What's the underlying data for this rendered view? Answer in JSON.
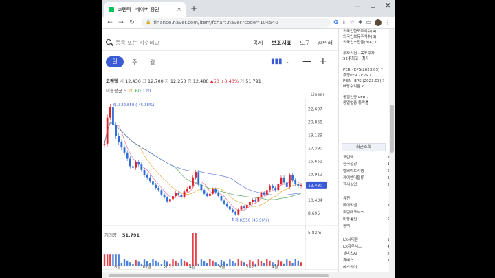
{
  "browser": {
    "tab_title": "코렌텍 : 네이버 증권",
    "tab_close": "×",
    "new_tab": "+",
    "url": "finance.naver.com/item/fchart.naver?code=104540",
    "back": "←",
    "forward": "→",
    "reload": "↻",
    "google": "G",
    "share": "⇪",
    "star": "☆",
    "extensions": "✱",
    "sidepanel": "▭",
    "menu": "⋮",
    "minimize": "—",
    "maximize": "☐",
    "close": "✕"
  },
  "search": {
    "placeholder": "종목 또는 지수비교"
  },
  "top_menu": {
    "notice": "공시",
    "indicator": "보조지표",
    "tool": "도구",
    "print": "인쇄"
  },
  "period": {
    "day": "일",
    "week": "주",
    "month": "월"
  },
  "controls": {
    "chart_type": "▮▮▮",
    "dropdown": "⌄",
    "zoom_out": "—",
    "zoom_in": "+"
  },
  "quote": {
    "name": "코렌텍",
    "open_label": "시",
    "open": "12,430",
    "high_label": "고",
    "high": "12,700",
    "low_label": "저",
    "low": "12,250",
    "close_label": "종",
    "close": "12,480",
    "change": "▲50",
    "change_pct": "+0.40%",
    "volume_label": "거",
    "volume": "51,791"
  },
  "ma": {
    "label": "이동평균",
    "ma5": "5",
    "ma20": "20",
    "ma60": "60",
    "ma120": "120"
  },
  "scale_mode": "Linear",
  "chart_data": {
    "type": "line",
    "x": [
      "6월",
      "10월",
      "2022",
      "4월",
      "8월",
      "2023",
      "4월"
    ],
    "y_ticks": [
      "22,607",
      "20,868",
      "19,129",
      "17,390",
      "15,651",
      "13,912",
      "12,480",
      "10,434",
      "8,695"
    ],
    "last_price_label": "12,480",
    "max_annotation": "최고 22,850 (-45.38%)",
    "min_annotation": "최저 8,550 (45.96%)",
    "volume_label": "거래량",
    "volume_value": "51,791",
    "volume_max_tick": "5.82m",
    "series": [
      {
        "values": [
          18000,
          21500,
          22850,
          20500,
          19000,
          18200,
          17500,
          16800,
          16000,
          15000,
          14800,
          15500,
          15200,
          14500,
          13800,
          13500,
          13000,
          12500,
          12100,
          11800,
          11200,
          10800,
          10300,
          10600,
          11000,
          11400,
          11200,
          10900,
          11600,
          12000,
          12400,
          13500,
          14200,
          12500,
          11800,
          11300,
          11000,
          11300,
          11900,
          11500,
          11000,
          10400,
          10000,
          9600,
          9200,
          8900,
          8550,
          9200,
          9600,
          9400,
          9800,
          10200,
          10500,
          10300,
          10900,
          11500,
          11200,
          11800,
          12400,
          12100,
          11800,
          12600,
          13500,
          12800,
          12200,
          13800,
          13200,
          12600,
          12300,
          12480
        ]
      }
    ],
    "colors": {
      "up": "#e0212a",
      "down": "#2d6fd6",
      "ma5": "#e46c94",
      "ma20": "#e2a325",
      "ma60": "#43a150",
      "ma120": "#5a6fd8",
      "price_badge": "#3b5bd6"
    }
  },
  "sidebar": {
    "info_lines": [
      "외국인한도주식수(A)",
      "외국인보유주식수(B)",
      "외국인소진율(B/A) ?",
      "",
      "투자의견 · 목표주가",
      "52주최고 · 최저",
      "",
      "PER · EPS(2023.03) ?",
      "추정PER · EPS ?",
      "PBR · BPS (2023.03) ?",
      "배당수익률 ?",
      "",
      "동일업종 PER ·",
      "동일업종 등락률 ·"
    ],
    "recent_title": "최근조회",
    "recent_items": [
      {
        "name": "코렌텍",
        "num": "1"
      },
      {
        "name": "한국철강",
        "num": "1"
      },
      {
        "name": "엘의아트라켐",
        "num": "2"
      },
      {
        "name": "케이엔더블류",
        "num": "3"
      },
      {
        "name": "한세실업",
        "num": "2"
      },
      {
        "name": "",
        "num": ""
      },
      {
        "name": "유진",
        "num": ""
      },
      {
        "name": "하이빅밸",
        "num": "1"
      },
      {
        "name": "퓌런테크닉스",
        "num": ""
      },
      {
        "name": "이동통신",
        "num": "9"
      },
      {
        "name": "동력",
        "num": ""
      },
      {
        "name": "",
        "num": ""
      },
      {
        "name": "LX세미콘",
        "num": "9"
      },
      {
        "name": "LX하우시스",
        "num": "4"
      },
      {
        "name": "셀바스AI",
        "num": "2"
      },
      {
        "name": "휴비스",
        "num": "1"
      },
      {
        "name": "에스와이",
        "num": ""
      }
    ]
  }
}
